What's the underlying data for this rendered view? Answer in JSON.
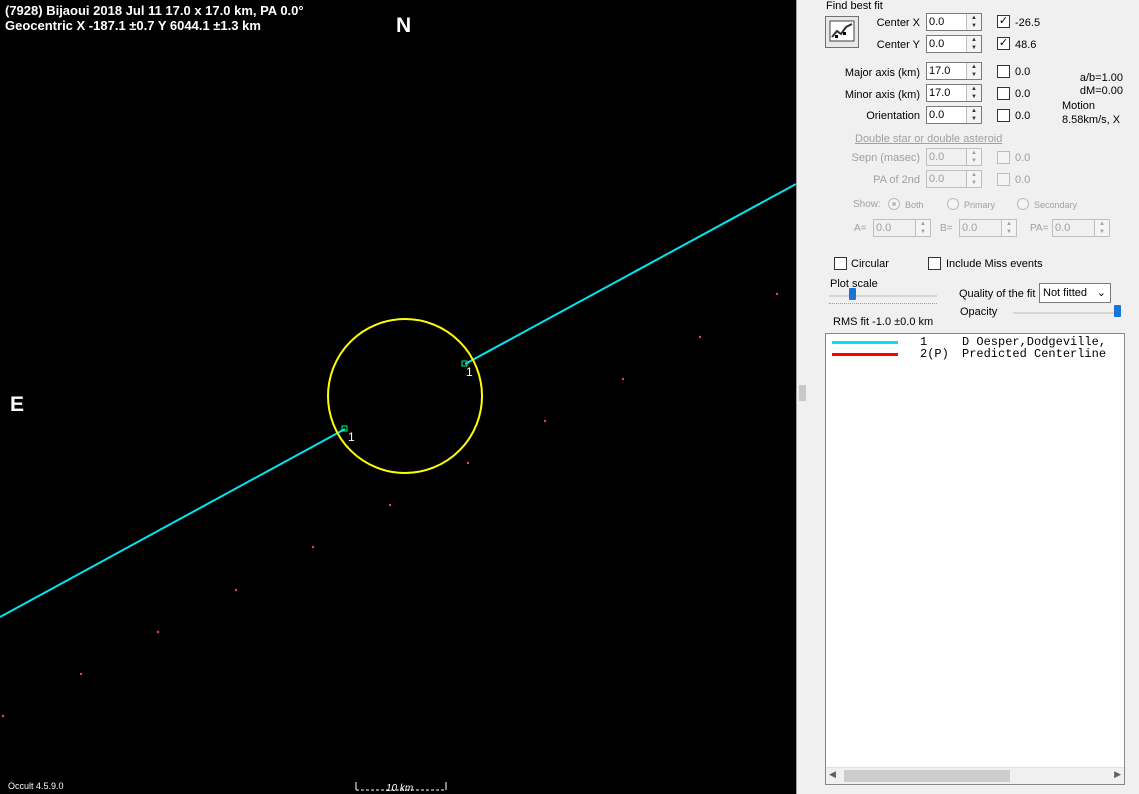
{
  "plot": {
    "header_line1": "(7928) Bijaoui  2018 Jul 11   17.0 x 17.0 km, PA 0.0°",
    "header_line2": "Geocentric  X  -187.1 ±0.7  Y 6044.1 ±1.3 km",
    "north_label": "N",
    "east_label": "E",
    "chord_labels": [
      "1",
      "1"
    ],
    "version": "Occult 4.5.9.0",
    "scale_label": "10 km",
    "colors": {
      "background": "#000000",
      "ellipse": "#ffff00",
      "chord": "#00e5ee",
      "predicted": "#ff4040",
      "text": "#ffffff"
    }
  },
  "panel": {
    "find_best_fit": "Find best fit",
    "fit_button_icon": "chart-fit-icon",
    "params": [
      {
        "label": "Center X",
        "value": "0.0",
        "checked": true,
        "result": "-26.5"
      },
      {
        "label": "Center Y",
        "value": "0.0",
        "checked": true,
        "result": "48.6"
      },
      {
        "label": "Major axis (km)",
        "value": "17.0",
        "checked": false,
        "result": "0.0"
      },
      {
        "label": "Minor axis (km)",
        "value": "17.0",
        "checked": false,
        "result": "0.0"
      },
      {
        "label": "Orientation",
        "value": "0.0",
        "checked": false,
        "result": "0.0"
      }
    ],
    "ab_ratio": "a/b=1.00",
    "dm": "dM=0.00",
    "motion_label": "Motion",
    "motion_value": "8.58km/s, X",
    "double_star_label": "Double star  or  double asteroid",
    "sepn_label": "Sepn (masec)",
    "sepn_value": "0.0",
    "sepn_result": "0.0",
    "pa2_label": "PA of 2nd",
    "pa2_value": "0.0",
    "pa2_result": "0.0",
    "show_label": "Show:",
    "show_options": [
      "Both",
      "Primary",
      "Secondary"
    ],
    "a_label": "A=",
    "a_value": "0.0",
    "b_label": "B=",
    "b_value": "0.0",
    "pa_label": "PA=",
    "pa_value": "0.0",
    "circular_label": "Circular",
    "include_miss_label": "Include Miss events",
    "plot_scale_label": "Plot scale",
    "quality_label": "Quality of the fit",
    "quality_value": "Not fitted",
    "opacity_label": "Opacity",
    "rms_label": "RMS fit -1.0 ±0.0 km",
    "legend": [
      {
        "num": "1",
        "text": "D Oesper,Dodgeville,",
        "color": "#00e5ee"
      },
      {
        "num": "2(P)",
        "text": "Predicted Centerline",
        "color": "#ff0000"
      }
    ]
  }
}
